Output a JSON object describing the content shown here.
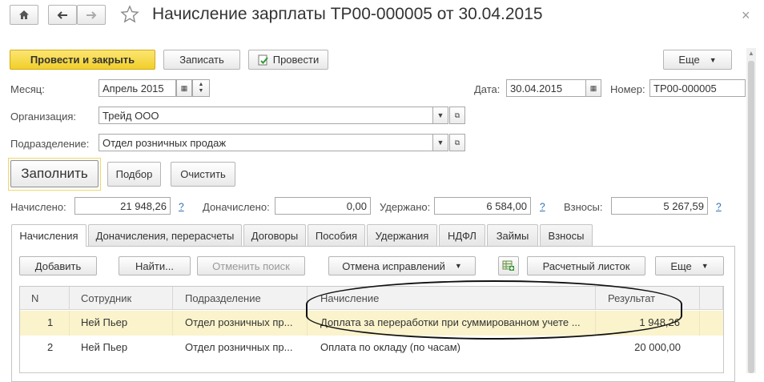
{
  "window": {
    "title": "Начисление зарплаты ТР00-000005 от 30.04.2015"
  },
  "toolbar": {
    "post_close": "Провести и закрыть",
    "save": "Записать",
    "post": "Провести",
    "more": "Еще"
  },
  "header": {
    "month_label": "Месяц:",
    "month_value": "Апрель 2015",
    "date_label": "Дата:",
    "date_value": "30.04.2015",
    "number_label": "Номер:",
    "number_value": "ТР00-000005",
    "org_label": "Организация:",
    "org_value": "Трейд ООО",
    "dept_label": "Подразделение:",
    "dept_value": "Отдел розничных продаж"
  },
  "actions": {
    "fill": "Заполнить",
    "select": "Подбор",
    "clear": "Очистить"
  },
  "totals": {
    "accrued_label": "Начислено:",
    "accrued_value": "21 948,26",
    "extra_label": "Доначислено:",
    "extra_value": "0,00",
    "withheld_label": "Удержано:",
    "withheld_value": "6 584,00",
    "contrib_label": "Взносы:",
    "contrib_value": "5 267,59",
    "help": "?"
  },
  "tabs": [
    "Начисления",
    "Доначисления, перерасчеты",
    "Договоры",
    "Пособия",
    "Удержания",
    "НДФЛ",
    "Займы",
    "Взносы"
  ],
  "table_toolbar": {
    "add": "Добавить",
    "find": "Найти...",
    "cancel_search": "Отменить поиск",
    "undo_fix": "Отмена исправлений",
    "payslip": "Расчетный листок",
    "more": "Еще"
  },
  "table": {
    "columns": [
      "N",
      "Сотрудник",
      "Подразделение",
      "Начисление",
      "Результат"
    ],
    "rows": [
      {
        "n": "1",
        "employee": "Ней Пьер",
        "dept": "Отдел розничных пр...",
        "accrual": "Доплата за переработки при суммированном учете ...",
        "result": "1 948,26"
      },
      {
        "n": "2",
        "employee": "Ней Пьер",
        "dept": "Отдел розничных пр...",
        "accrual": "Оплата по окладу (по часам)",
        "result": "20 000,00"
      }
    ]
  },
  "colors": {
    "accent_button": "#f5d63a",
    "selected_row": "#faf3cc",
    "link": "#2d6fb2"
  }
}
